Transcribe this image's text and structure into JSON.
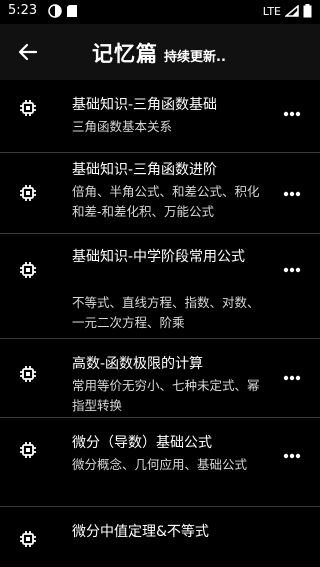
{
  "status": {
    "time": "5:23",
    "network": "LTE"
  },
  "header": {
    "title": "记忆篇",
    "subtitle": "持续更新.."
  },
  "items": [
    {
      "title": "基础知识-三角函数基础",
      "subtitle": "三角函数基本关系"
    },
    {
      "title": "基础知识-三角函数进阶",
      "subtitle": "倍角、半角公式、和差公式、积化和差-和差化积、万能公式"
    },
    {
      "title": "基础知识-中学阶段常用公式",
      "subtitle": "不等式、直线方程、指数、对数、一元二次方程、阶乘"
    },
    {
      "title": "高数-函数极限的计算",
      "subtitle": "常用等价无穷小、七种未定式、幂指型转换"
    },
    {
      "title": "微分（导数）基础公式",
      "subtitle": "微分概念、几何应用、基础公式"
    },
    {
      "title": "微分中值定理&不等式",
      "subtitle": ""
    }
  ]
}
